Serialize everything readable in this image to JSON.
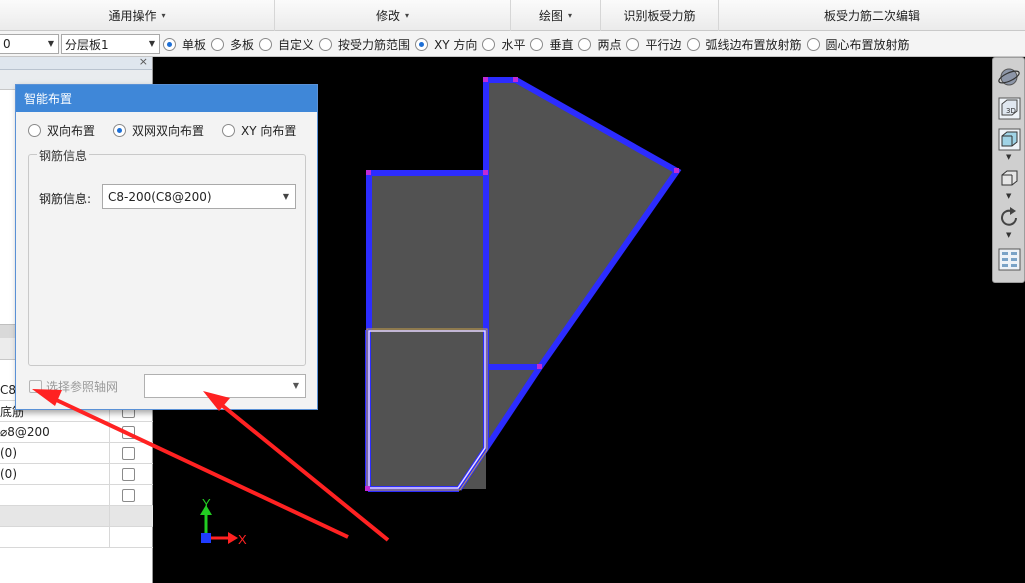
{
  "ribbon": {
    "groups": [
      {
        "label": "通用操作",
        "caret": "▾"
      },
      {
        "label": "修改",
        "caret": "▾"
      },
      {
        "label": "绘图",
        "caret": "▾"
      },
      {
        "label": "识别板受力筋",
        "caret": ""
      },
      {
        "label": "板受力筋二次编辑",
        "caret": ""
      }
    ]
  },
  "toolbar": {
    "floor_combo": "0",
    "layer_combo": "分层板1",
    "radios": [
      {
        "label": "单板",
        "checked": true
      },
      {
        "label": "多板",
        "checked": false
      },
      {
        "label": "自定义",
        "checked": false
      },
      {
        "label": "按受力筋范围",
        "checked": false
      },
      {
        "label": "XY 方向",
        "checked": true
      },
      {
        "label": "水平",
        "checked": false
      },
      {
        "label": "垂直",
        "checked": false
      },
      {
        "label": "两点",
        "checked": false
      },
      {
        "label": "平行边",
        "checked": false
      },
      {
        "label": "弧线边布置放射筋",
        "checked": false
      },
      {
        "label": "圆心布置放射筋",
        "checked": false
      }
    ]
  },
  "left_panel": {
    "close_glyph": "×",
    "rows": [
      "C8",
      "底筋",
      "⌀8@200",
      "(0)",
      "(0)",
      "",
      "",
      ""
    ]
  },
  "dialog": {
    "title": "智能布置",
    "modes": [
      {
        "label": "双向布置",
        "checked": false
      },
      {
        "label": "双网双向布置",
        "checked": true
      },
      {
        "label": "XY 向布置",
        "checked": false
      }
    ],
    "group_title": "钢筋信息",
    "field_label": "钢筋信息:",
    "field_value": "C8-200(C8@200)",
    "ref_axis_label": "选择参照轴网",
    "ref_axis_value": ""
  },
  "viewport": {
    "axis_y": "Y",
    "axis_x": "X",
    "slab_fill": "#525252",
    "slab_edge": "#2c2cff",
    "highlight_edge": "#e8d8ff",
    "arrow_color": "#ff2222"
  },
  "navbar": {
    "icons": [
      "orbit-icon",
      "view-3d-icon",
      "cube-front-icon",
      "cube-side-icon",
      "rotate-icon",
      "grid-view-icon"
    ]
  }
}
